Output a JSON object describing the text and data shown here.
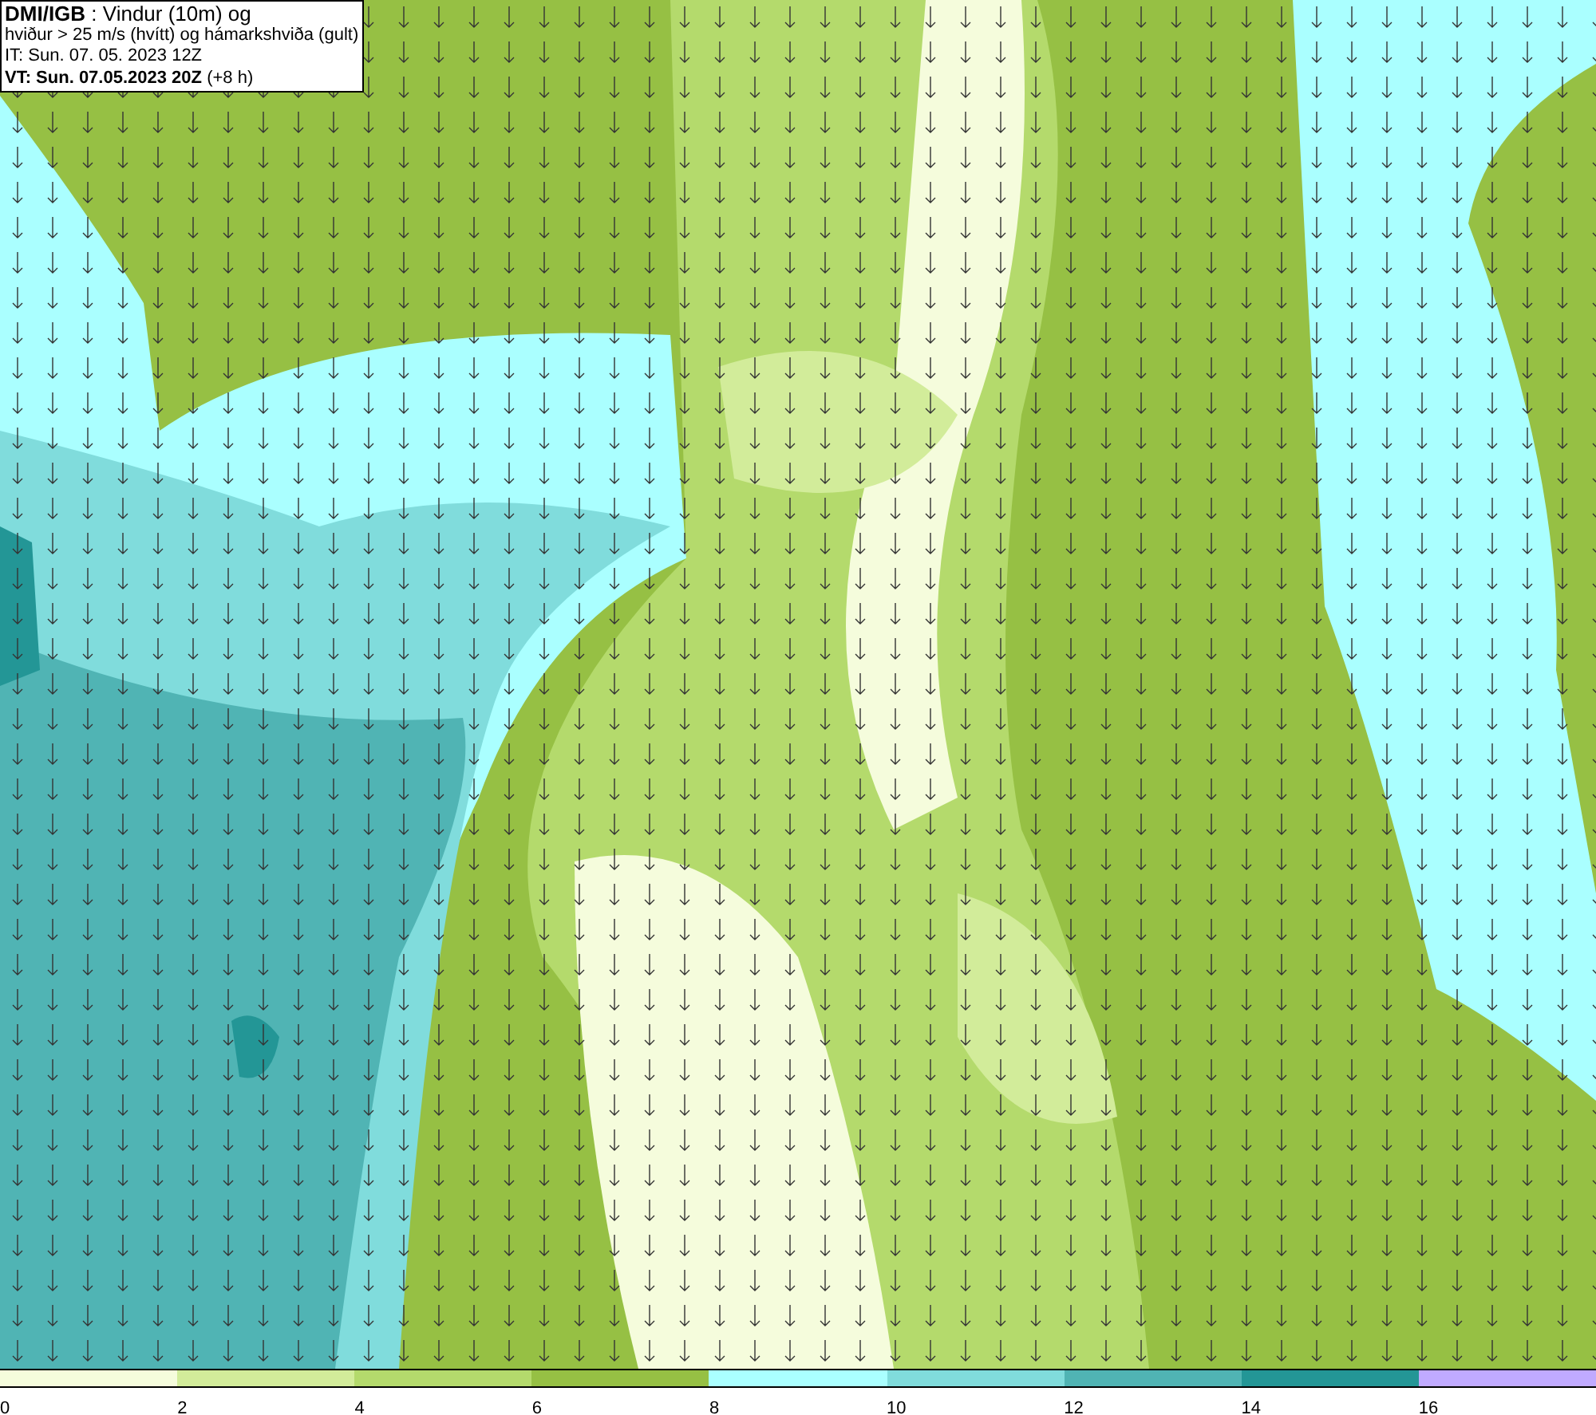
{
  "header": {
    "lines": [
      "**DMI/IGB** : Vindur (10m) og",
      "hviður > 25 m/s (hvítt) og hámarkshviða (gult)",
      "IT: Sun. 07. 05. 2023 12Z",
      "**VT: Sun. 07.05.2023 20Z** (+8 h)"
    ]
  },
  "legend": {
    "bins": [
      {
        "label": "0",
        "color": "#f5fcdc"
      },
      {
        "label": "2",
        "color": "#d2ec9a"
      },
      {
        "label": "4",
        "color": "#b4da6c"
      },
      {
        "label": "6",
        "color": "#96c044"
      },
      {
        "label": "8",
        "color": "#aaffff"
      },
      {
        "label": "10",
        "color": "#80dcdc"
      },
      {
        "label": "12",
        "color": "#50b4b4"
      },
      {
        "label": "14",
        "color": "#239696"
      },
      {
        "label": "16",
        "color": "#c0aaff"
      }
    ]
  }
}
